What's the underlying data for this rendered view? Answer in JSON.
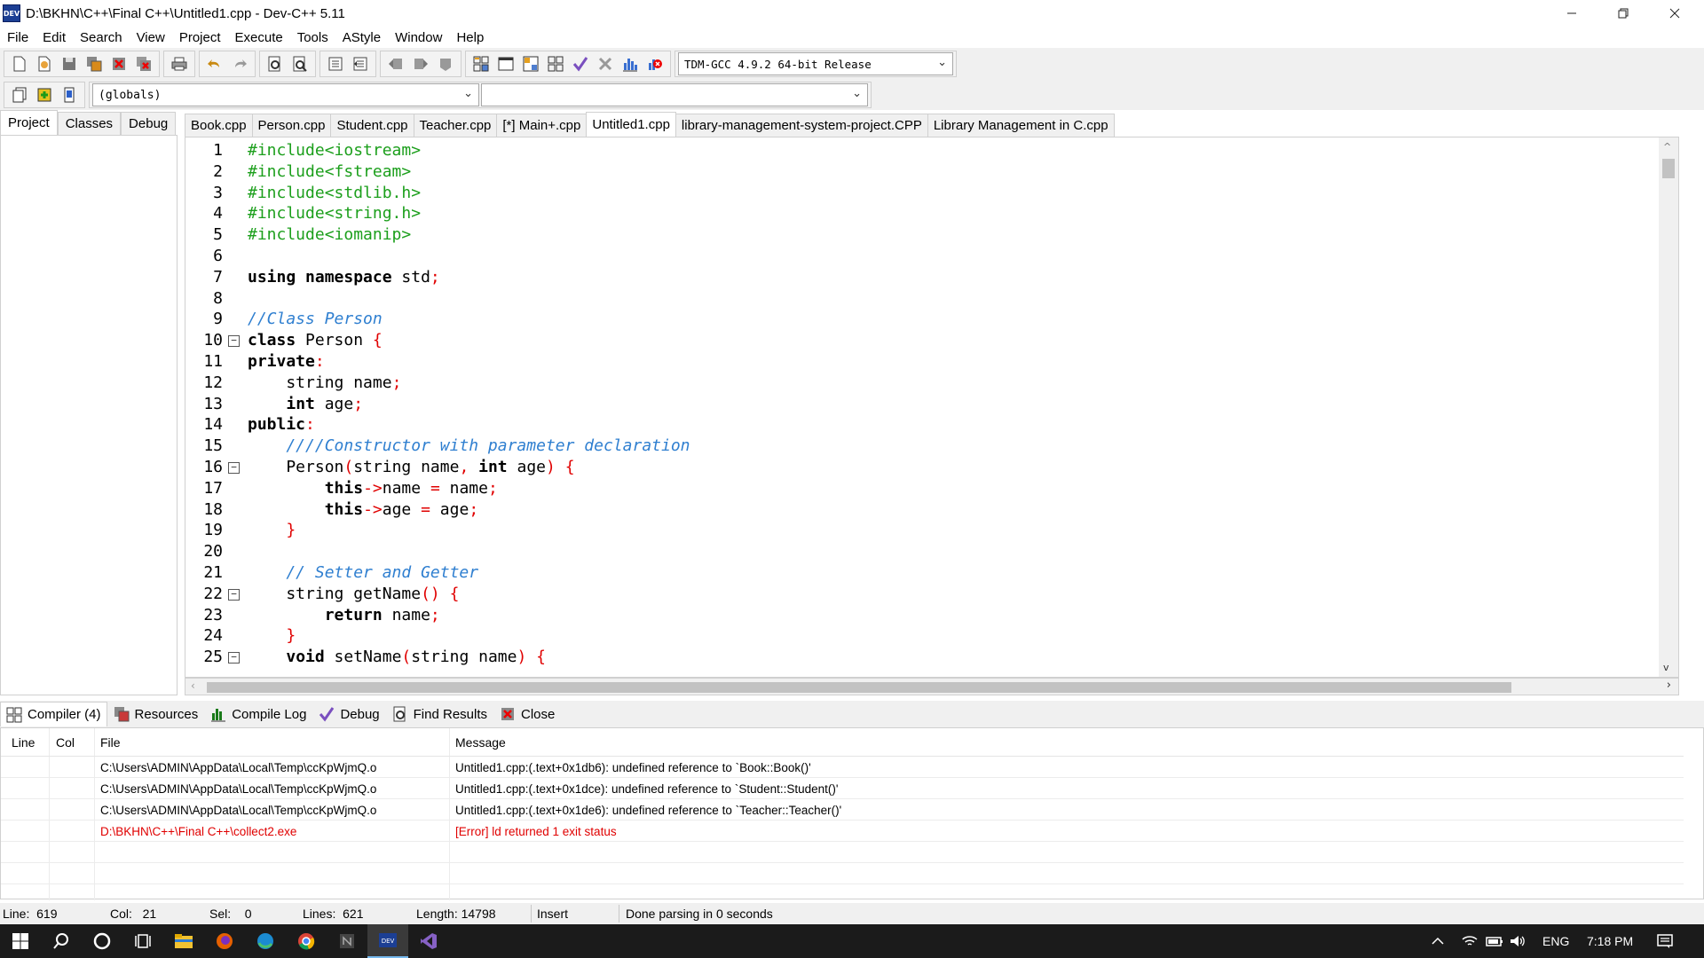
{
  "window": {
    "title": "D:\\BKHN\\C++\\Final C++\\Untitled1.cpp - Dev-C++ 5.11",
    "app_icon_text": "DEV",
    "controls": [
      "minimize-icon",
      "restore-icon",
      "close-icon"
    ]
  },
  "menu": [
    "File",
    "Edit",
    "Search",
    "View",
    "Project",
    "Execute",
    "Tools",
    "AStyle",
    "Window",
    "Help"
  ],
  "toolbar": {
    "compiler_select": "TDM-GCC 4.9.2 64-bit Release",
    "scope_select": "(globals)",
    "function_select": ""
  },
  "left_panel": {
    "tabs": [
      "Project",
      "Classes",
      "Debug"
    ],
    "active": "Project"
  },
  "editor_tabs": {
    "tabs": [
      "Book.cpp",
      "Person.cpp",
      "Student.cpp",
      "Teacher.cpp",
      "[*] Main+.cpp",
      "Untitled1.cpp",
      "library-management-system-project.CPP",
      "Library Management in C.cpp"
    ],
    "active": "Untitled1.cpp"
  },
  "code_lines": [
    {
      "n": "1",
      "fold": "",
      "parts": [
        {
          "t": "#include<iostream>",
          "c": "pp"
        }
      ]
    },
    {
      "n": "2",
      "fold": "",
      "parts": [
        {
          "t": "#include<fstream>",
          "c": "pp"
        }
      ]
    },
    {
      "n": "3",
      "fold": "",
      "parts": [
        {
          "t": "#include<stdlib.h>",
          "c": "pp"
        }
      ]
    },
    {
      "n": "4",
      "fold": "",
      "parts": [
        {
          "t": "#include<string.h>",
          "c": "pp"
        }
      ]
    },
    {
      "n": "5",
      "fold": "",
      "parts": [
        {
          "t": "#include<iomanip>",
          "c": "pp"
        }
      ]
    },
    {
      "n": "6",
      "fold": "",
      "parts": []
    },
    {
      "n": "7",
      "fold": "",
      "parts": [
        {
          "t": "using namespace",
          "c": "kw"
        },
        {
          "t": " std",
          "c": ""
        },
        {
          "t": ";",
          "c": "sy"
        }
      ]
    },
    {
      "n": "8",
      "fold": "",
      "parts": []
    },
    {
      "n": "9",
      "fold": "",
      "parts": [
        {
          "t": "//Class Person",
          "c": "cm"
        }
      ]
    },
    {
      "n": "10",
      "fold": "−",
      "parts": [
        {
          "t": "class",
          "c": "kw"
        },
        {
          "t": " Person ",
          "c": ""
        },
        {
          "t": "{",
          "c": "sy"
        }
      ]
    },
    {
      "n": "11",
      "fold": "",
      "parts": [
        {
          "t": "private",
          "c": "kw"
        },
        {
          "t": ":",
          "c": "sy"
        }
      ]
    },
    {
      "n": "12",
      "fold": "",
      "parts": [
        {
          "t": "    string name",
          "c": ""
        },
        {
          "t": ";",
          "c": "sy"
        }
      ]
    },
    {
      "n": "13",
      "fold": "",
      "parts": [
        {
          "t": "    ",
          "c": ""
        },
        {
          "t": "int",
          "c": "kw"
        },
        {
          "t": " age",
          "c": ""
        },
        {
          "t": ";",
          "c": "sy"
        }
      ]
    },
    {
      "n": "14",
      "fold": "",
      "parts": [
        {
          "t": "public",
          "c": "kw"
        },
        {
          "t": ":",
          "c": "sy"
        }
      ]
    },
    {
      "n": "15",
      "fold": "",
      "parts": [
        {
          "t": "    ////Constructor with parameter declaration",
          "c": "cm"
        }
      ]
    },
    {
      "n": "16",
      "fold": "−",
      "parts": [
        {
          "t": "    Person",
          "c": ""
        },
        {
          "t": "(",
          "c": "sy"
        },
        {
          "t": "string name",
          "c": ""
        },
        {
          "t": ",",
          "c": "sy"
        },
        {
          "t": " ",
          "c": ""
        },
        {
          "t": "int",
          "c": "kw"
        },
        {
          "t": " age",
          "c": ""
        },
        {
          "t": ")",
          "c": "sy"
        },
        {
          "t": " ",
          "c": ""
        },
        {
          "t": "{",
          "c": "sy"
        }
      ]
    },
    {
      "n": "17",
      "fold": "",
      "parts": [
        {
          "t": "        ",
          "c": ""
        },
        {
          "t": "this",
          "c": "kw"
        },
        {
          "t": "->",
          "c": "sy"
        },
        {
          "t": "name ",
          "c": ""
        },
        {
          "t": "=",
          "c": "sy"
        },
        {
          "t": " name",
          "c": ""
        },
        {
          "t": ";",
          "c": "sy"
        }
      ]
    },
    {
      "n": "18",
      "fold": "",
      "parts": [
        {
          "t": "        ",
          "c": ""
        },
        {
          "t": "this",
          "c": "kw"
        },
        {
          "t": "->",
          "c": "sy"
        },
        {
          "t": "age ",
          "c": ""
        },
        {
          "t": "=",
          "c": "sy"
        },
        {
          "t": " age",
          "c": ""
        },
        {
          "t": ";",
          "c": "sy"
        }
      ]
    },
    {
      "n": "19",
      "fold": "",
      "parts": [
        {
          "t": "    ",
          "c": ""
        },
        {
          "t": "}",
          "c": "sy"
        }
      ]
    },
    {
      "n": "20",
      "fold": "",
      "parts": []
    },
    {
      "n": "21",
      "fold": "",
      "parts": [
        {
          "t": "    // Setter and Getter",
          "c": "cm"
        }
      ]
    },
    {
      "n": "22",
      "fold": "−",
      "parts": [
        {
          "t": "    string getName",
          "c": ""
        },
        {
          "t": "()",
          "c": "sy"
        },
        {
          "t": " ",
          "c": ""
        },
        {
          "t": "{",
          "c": "sy"
        }
      ]
    },
    {
      "n": "23",
      "fold": "",
      "parts": [
        {
          "t": "        ",
          "c": ""
        },
        {
          "t": "return",
          "c": "kw"
        },
        {
          "t": " name",
          "c": ""
        },
        {
          "t": ";",
          "c": "sy"
        }
      ]
    },
    {
      "n": "24",
      "fold": "",
      "parts": [
        {
          "t": "    ",
          "c": ""
        },
        {
          "t": "}",
          "c": "sy"
        }
      ]
    },
    {
      "n": "25",
      "fold": "−",
      "parts": [
        {
          "t": "    ",
          "c": ""
        },
        {
          "t": "void",
          "c": "kw"
        },
        {
          "t": " setName",
          "c": ""
        },
        {
          "t": "(",
          "c": "sy"
        },
        {
          "t": "string name",
          "c": ""
        },
        {
          "t": ")",
          "c": "sy"
        },
        {
          "t": " ",
          "c": ""
        },
        {
          "t": "{",
          "c": "sy"
        }
      ]
    }
  ],
  "bottom_tabs": [
    {
      "label": "Compiler (4)",
      "icon": "compiler-grid-icon"
    },
    {
      "label": "Resources",
      "icon": "resources-icon"
    },
    {
      "label": "Compile Log",
      "icon": "compile-log-chart-icon"
    },
    {
      "label": "Debug",
      "icon": "debug-check-icon"
    },
    {
      "label": "Find Results",
      "icon": "find-results-icon"
    },
    {
      "label": "Close",
      "icon": "close-panel-icon"
    }
  ],
  "messages": {
    "headers": {
      "line": "Line",
      "col": "Col",
      "file": "File",
      "message": "Message"
    },
    "rows": [
      {
        "line": "",
        "col": "",
        "file": "C:\\Users\\ADMIN\\AppData\\Local\\Temp\\ccKpWjmQ.o",
        "message": "Untitled1.cpp:(.text+0x1db6): undefined reference to `Book::Book()'",
        "error": false
      },
      {
        "line": "",
        "col": "",
        "file": "C:\\Users\\ADMIN\\AppData\\Local\\Temp\\ccKpWjmQ.o",
        "message": "Untitled1.cpp:(.text+0x1dce): undefined reference to `Student::Student()'",
        "error": false
      },
      {
        "line": "",
        "col": "",
        "file": "C:\\Users\\ADMIN\\AppData\\Local\\Temp\\ccKpWjmQ.o",
        "message": "Untitled1.cpp:(.text+0x1de6): undefined reference to `Teacher::Teacher()'",
        "error": false
      },
      {
        "line": "",
        "col": "",
        "file": "D:\\BKHN\\C++\\Final C++\\collect2.exe",
        "message": "[Error] ld returned 1 exit status",
        "error": true
      }
    ]
  },
  "status": {
    "line_label": "Line:",
    "line": "619",
    "col_label": "Col:",
    "col": "21",
    "sel_label": "Sel:",
    "sel": "0",
    "lines_label": "Lines:",
    "lines": "621",
    "length_label": "Length:",
    "length": "14798",
    "mode": "Insert",
    "message": "Done parsing in 0 seconds"
  },
  "taskbar": {
    "lang": "ENG",
    "time": "7:18 PM"
  },
  "colors": {
    "preprocessor": "#1c9f1c",
    "comment": "#2f7fd0",
    "symbol": "#e00000",
    "error_text": "#e00000",
    "taskbar": "#1b1b1b"
  }
}
